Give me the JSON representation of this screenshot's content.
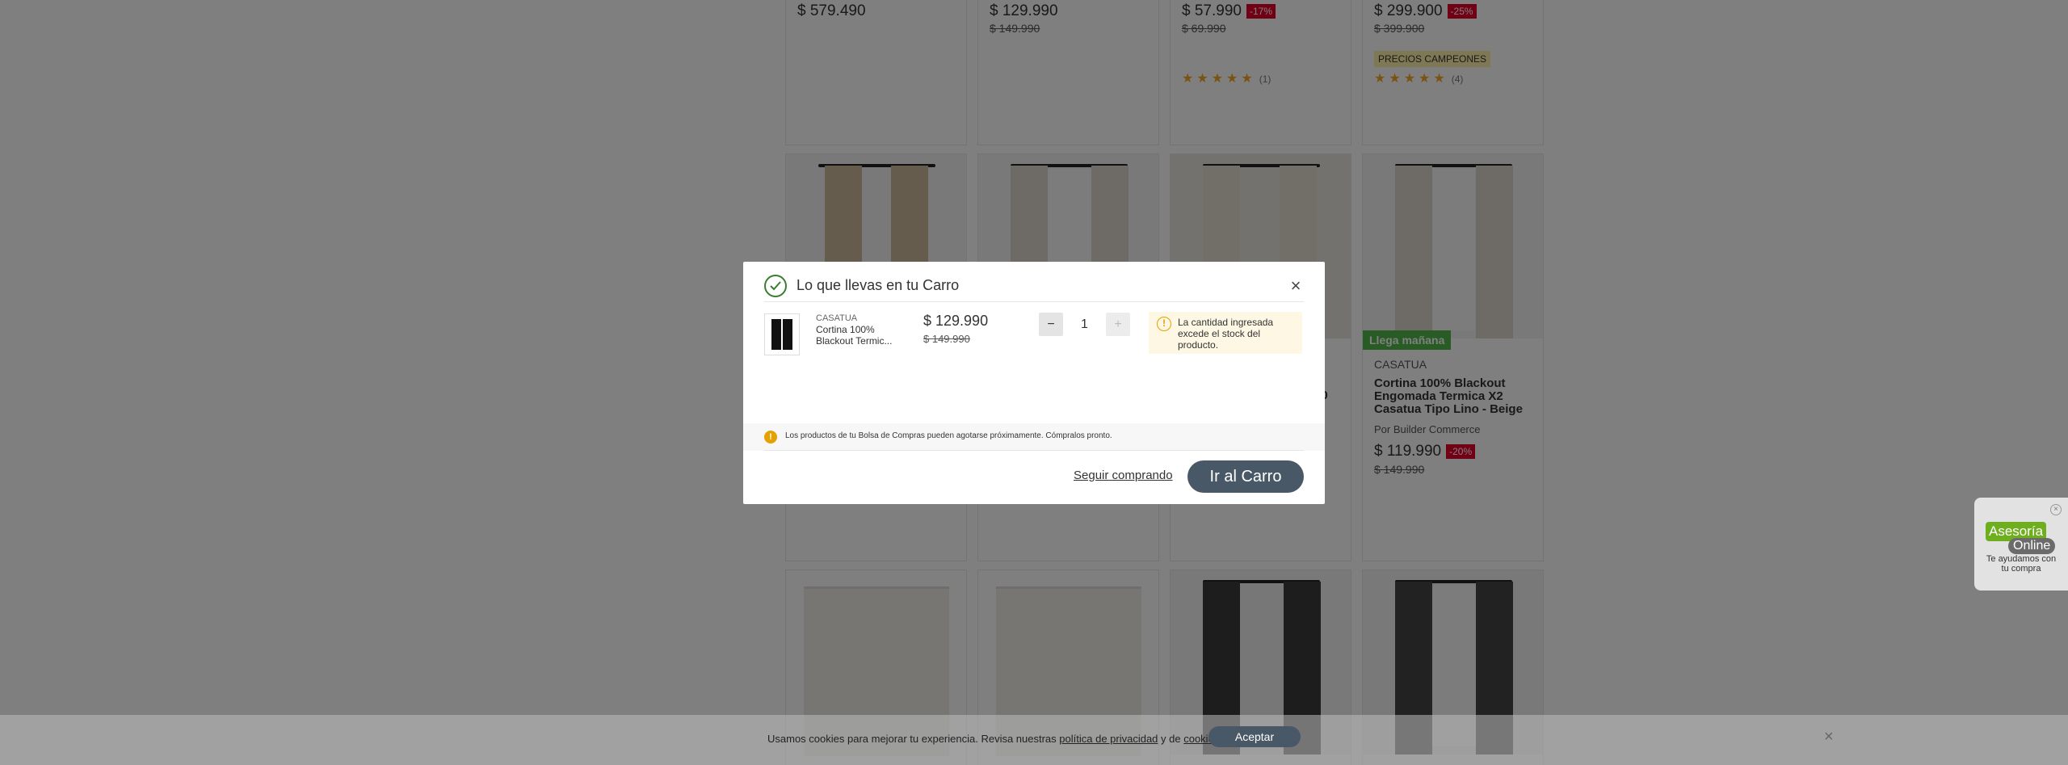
{
  "background": {
    "cards": [
      {
        "price": "$ 579.490"
      },
      {
        "price": "$ 129.990",
        "old": "$ 149.990"
      },
      {
        "price": "$ 57.990",
        "discount": "-17%",
        "old": "$ 69.990",
        "reviews": "(1)"
      },
      {
        "price": "$ 299.900",
        "discount": "-25%",
        "old": "$ 399.900",
        "tag": "PRECIOS CAMPEONES",
        "reviews": "(4)"
      }
    ],
    "featured": {
      "delivery": "Llega mañana",
      "brand": "CASATUA",
      "name": "Cortina 100% Blackout Engomada Termica X2 Casatua Tipo Lino - Beige",
      "seller": "Por Builder Commerce",
      "price": "$ 119.990",
      "discount": "-20%",
      "old": "$ 149.990"
    },
    "partial_text": "20",
    "stars": "★★★★★"
  },
  "modal": {
    "title": "Lo que llevas en tu Carro",
    "close": "×",
    "item": {
      "brand": "CASATUA",
      "name": "Cortina 100% Blackout Termic...",
      "price": "$ 129.990",
      "old_price": "$ 149.990",
      "quantity": "1",
      "minus": "−",
      "plus": "+"
    },
    "warning": "La cantidad ingresada excede el stock del producto.",
    "notice": "Los productos de tu Bolsa de Compras pueden agotarse próximamente. Cómpralos pronto.",
    "continue_label": "Seguir comprando",
    "cart_label": "Ir al Carro"
  },
  "cookie": {
    "text_before": "Usamos cookies para mejorar tu experiencia. Revisa nuestras ",
    "link1": "política de privacidad",
    "text_mid": " y de ",
    "link2": "cookies",
    "text_end": ".",
    "accept": "Aceptar",
    "close": "×"
  },
  "chat": {
    "tag1": "Asesoría",
    "tag2": "Online",
    "subtitle": "Te ayudamos con tu compra",
    "close": "×"
  },
  "colors": {
    "primary_button": "#495867",
    "discount": "#e4002b",
    "delivery": "#50b848",
    "check": "#3a7d2f",
    "warning": "#e5a100"
  }
}
